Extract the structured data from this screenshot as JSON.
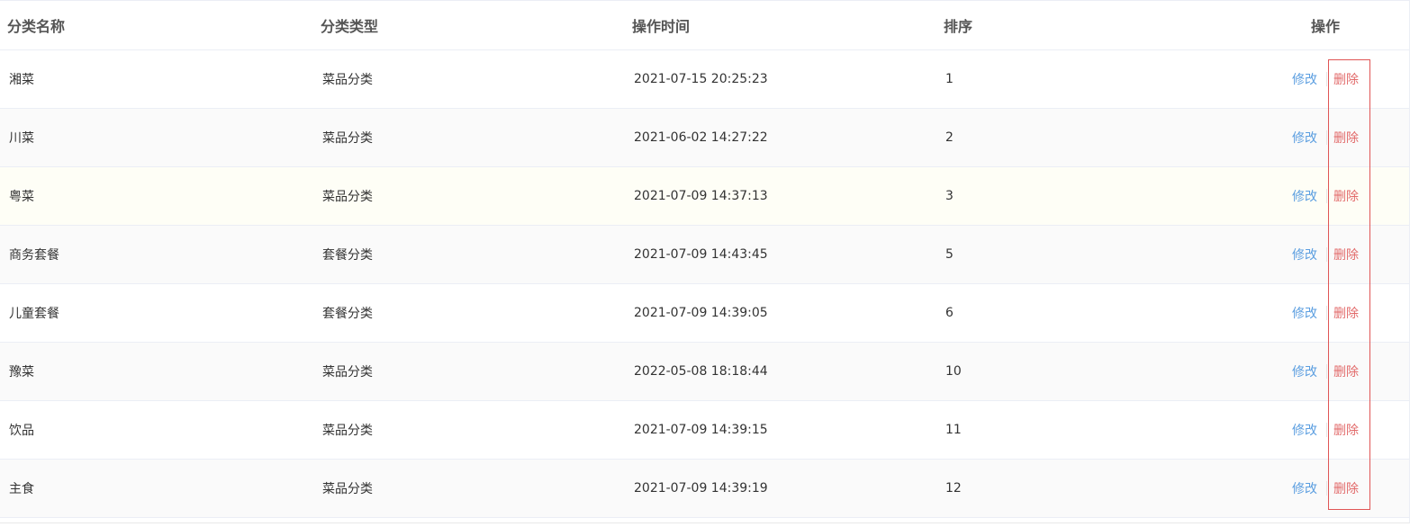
{
  "table": {
    "headers": {
      "name": "分类名称",
      "type": "分类类型",
      "time": "操作时间",
      "sort": "排序",
      "operation": "操作"
    },
    "rows": [
      {
        "name": "湘菜",
        "type": "菜品分类",
        "time": "2021-07-15 20:25:23",
        "sort": "1",
        "edit": "修改",
        "delete": "删除"
      },
      {
        "name": "川菜",
        "type": "菜品分类",
        "time": "2021-06-02 14:27:22",
        "sort": "2",
        "edit": "修改",
        "delete": "删除"
      },
      {
        "name": "粤菜",
        "type": "菜品分类",
        "time": "2021-07-09 14:37:13",
        "sort": "3",
        "edit": "修改",
        "delete": "删除"
      },
      {
        "name": "商务套餐",
        "type": "套餐分类",
        "time": "2021-07-09 14:43:45",
        "sort": "5",
        "edit": "修改",
        "delete": "删除"
      },
      {
        "name": "儿童套餐",
        "type": "套餐分类",
        "time": "2021-07-09 14:39:05",
        "sort": "6",
        "edit": "修改",
        "delete": "删除"
      },
      {
        "name": "豫菜",
        "type": "菜品分类",
        "time": "2022-05-08 18:18:44",
        "sort": "10",
        "edit": "修改",
        "delete": "删除"
      },
      {
        "name": "饮品",
        "type": "菜品分类",
        "time": "2021-07-09 14:39:15",
        "sort": "11",
        "edit": "修改",
        "delete": "删除"
      },
      {
        "name": "主食",
        "type": "菜品分类",
        "time": "2021-07-09 14:39:19",
        "sort": "12",
        "edit": "修改",
        "delete": "删除"
      }
    ]
  },
  "colors": {
    "edit_link": "#5b9ee0",
    "delete_link": "#e26a6a",
    "highlight_border": "#e05555",
    "striped_row": "#fafafa",
    "hovered_row": "#fefef6"
  }
}
